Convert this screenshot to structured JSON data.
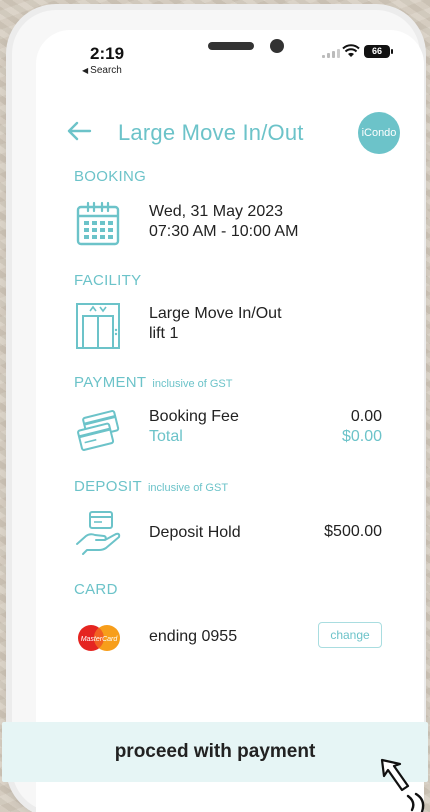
{
  "status_bar": {
    "time": "2:19",
    "back_app": "Search",
    "battery": "66"
  },
  "header": {
    "title": "Large Move In/Out",
    "brand": "iCondo"
  },
  "booking": {
    "label": "BOOKING",
    "date": "Wed, 31 May 2023",
    "time_range": "07:30 AM - 10:00 AM"
  },
  "facility": {
    "label": "FACILITY",
    "name": "Large Move In/Out",
    "detail": "lift 1"
  },
  "payment": {
    "label": "PAYMENT",
    "note": "inclusive of GST",
    "fee_label": "Booking Fee",
    "fee_value": "0.00",
    "total_label": "Total",
    "total_value": "$0.00"
  },
  "deposit": {
    "label": "DEPOSIT",
    "note": "inclusive of GST",
    "hold_label": "Deposit Hold",
    "hold_value": "$500.00"
  },
  "card": {
    "label": "CARD",
    "ending": "ending 0955",
    "change_label": "change",
    "brand_text": "MasterCard"
  },
  "proceed_label": "proceed with payment",
  "colors": {
    "accent": "#6cc3c9",
    "accent_light": "#e6f5f5"
  }
}
